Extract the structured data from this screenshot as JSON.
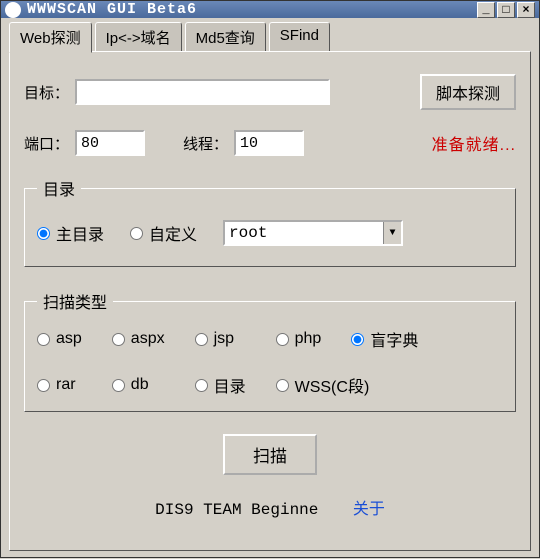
{
  "window": {
    "title": "WWWSCAN GUI Beta6"
  },
  "tabs": [
    {
      "label": "Web探测"
    },
    {
      "label": "Ip<->域名"
    },
    {
      "label": "Md5查询"
    },
    {
      "label": "SFind"
    }
  ],
  "form": {
    "target_label": "目标：",
    "target_value": "",
    "script_probe_btn": "脚本探测",
    "port_label": "端口：",
    "port_value": "80",
    "thread_label": "线程：",
    "thread_value": "10",
    "status_text": "准备就绪..."
  },
  "dir_group": {
    "legend": "目录",
    "main_dir": "主目录",
    "custom": "自定义",
    "combo_value": "root"
  },
  "scan_group": {
    "legend": "扫描类型",
    "options": [
      "asp",
      "aspx",
      "jsp",
      "php",
      "盲字典",
      "rar",
      "db",
      "目录",
      "WSS(C段)"
    ]
  },
  "scan_button": "扫描",
  "footer": {
    "team": "DIS9 TEAM Beginne",
    "about": "关于"
  }
}
